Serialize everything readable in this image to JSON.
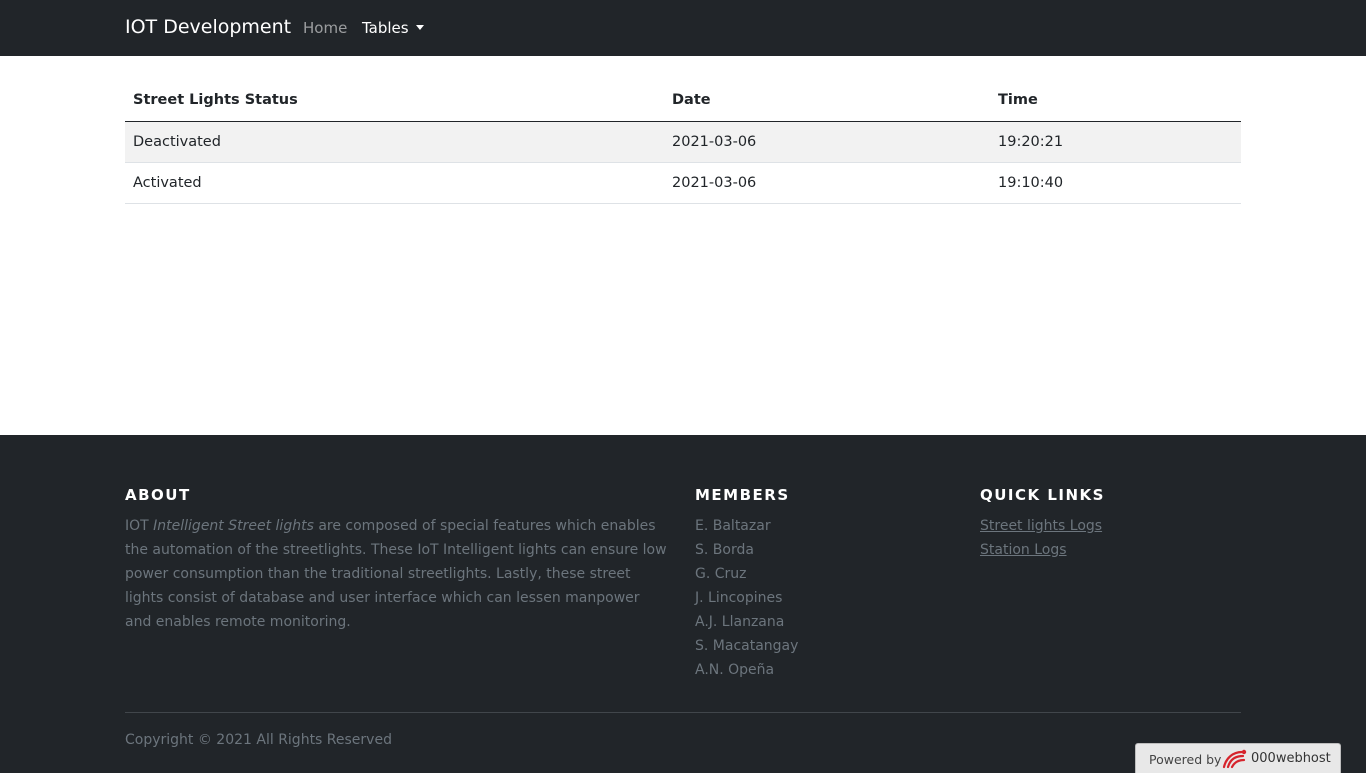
{
  "navbar": {
    "brand": "IOT Development",
    "home": "Home",
    "tables": "Tables"
  },
  "table": {
    "headers": [
      "Street Lights Status",
      "Date",
      "Time"
    ],
    "rows": [
      [
        "Deactivated",
        "2021-03-06",
        "19:20:21"
      ],
      [
        "Activated",
        "2021-03-06",
        "19:10:40"
      ]
    ]
  },
  "footer": {
    "about": {
      "heading": "ABOUT",
      "text_prefix": "IOT ",
      "text_italic": "Intelligent Street lights",
      "text_rest": " are composed of special features which enables the automation of the streetlights. These IoT Intelligent lights can ensure low power consumption than the traditional streetlights. Lastly, these street lights consist of database and user interface which can lessen manpower and enables remote monitoring."
    },
    "members": {
      "heading": "MEMBERS",
      "names": [
        "E. Baltazar",
        "S. Borda",
        "G. Cruz",
        "J. Lincopines",
        "A.J. Llanzana",
        "S. Macatangay",
        "A.N. Opeña"
      ]
    },
    "quick_links": {
      "heading": "QUICK LINKS",
      "links": [
        "Street lights Logs",
        "Station Logs"
      ]
    },
    "copyright": "Copyright © 2021 All Rights Reserved"
  },
  "webhost": {
    "powered": "Powered by",
    "name": "000webhost",
    "logo_icon": "000webhost-logo-icon",
    "logo_color": "#d6242c"
  },
  "colors": {
    "navbar_bg": "#212529",
    "footer_bg": "#212529",
    "muted_text": "#6c757d",
    "striped_row": "#f2f2f2"
  }
}
